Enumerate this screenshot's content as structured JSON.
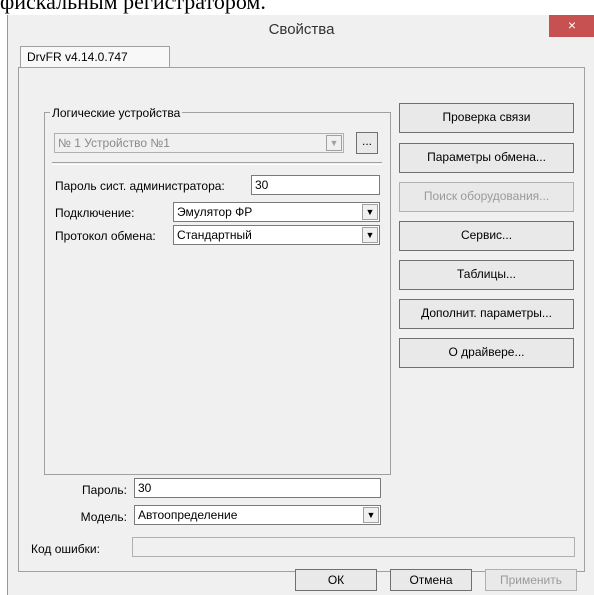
{
  "document": {
    "caption": "фискальным регистратором."
  },
  "window": {
    "title": "Свойства",
    "close_label": "×"
  },
  "tab": {
    "label": "DrvFR v4.14.0.747"
  },
  "logical_devices": {
    "group_label": "Логические устройства",
    "selected": "№ 1 Устройство №1",
    "browse_label": "..."
  },
  "admin_password": {
    "label": "Пароль сист. администратора:",
    "value": "30"
  },
  "connection": {
    "label": "Подключение:",
    "value": "Эмулятор ФР"
  },
  "protocol": {
    "label": "Протокол обмена:",
    "value": "Стандартный"
  },
  "password": {
    "label": "Пароль:",
    "value": "30"
  },
  "model": {
    "label": "Модель:",
    "value": "Автоопределение"
  },
  "error_code": {
    "label": "Код ошибки:",
    "value": ""
  },
  "side_buttons": {
    "check_connection": "Проверка связи",
    "exchange_params": "Параметры обмена...",
    "find_equipment": "Поиск оборудования...",
    "service": "Сервис...",
    "tables": "Таблицы...",
    "extra_params": "Дополнит. параметры...",
    "about_driver": "О драйвере..."
  },
  "footer": {
    "ok": "ОК",
    "cancel": "Отмена",
    "apply": "Применить"
  },
  "icons": {
    "dropdown": "▼",
    "dropdown_disabled": "▼"
  }
}
